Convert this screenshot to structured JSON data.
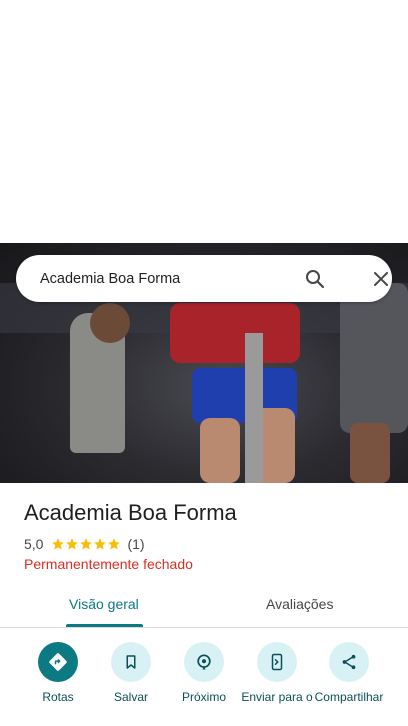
{
  "search": {
    "query": "Academia Boa Forma"
  },
  "place": {
    "name": "Academia Boa Forma",
    "rating": "5,0",
    "review_count": "(1)",
    "stars": 5,
    "status": "Permanentemente fechado"
  },
  "tabs": [
    {
      "label": "Visão geral",
      "active": true
    },
    {
      "label": "Avaliações",
      "active": false
    }
  ],
  "actions": [
    {
      "label": "Rotas",
      "icon": "directions-icon"
    },
    {
      "label": "Salvar",
      "icon": "bookmark-icon"
    },
    {
      "label": "Próximo",
      "icon": "nearby-icon"
    },
    {
      "label": "Enviar para o",
      "icon": "send-to-phone-icon"
    },
    {
      "label": "Compartilhar",
      "icon": "share-icon"
    }
  ],
  "colors": {
    "accent": "#0b7a82",
    "closed": "#d93025",
    "star": "#fbbc04",
    "chip": "#d8f1f5"
  }
}
